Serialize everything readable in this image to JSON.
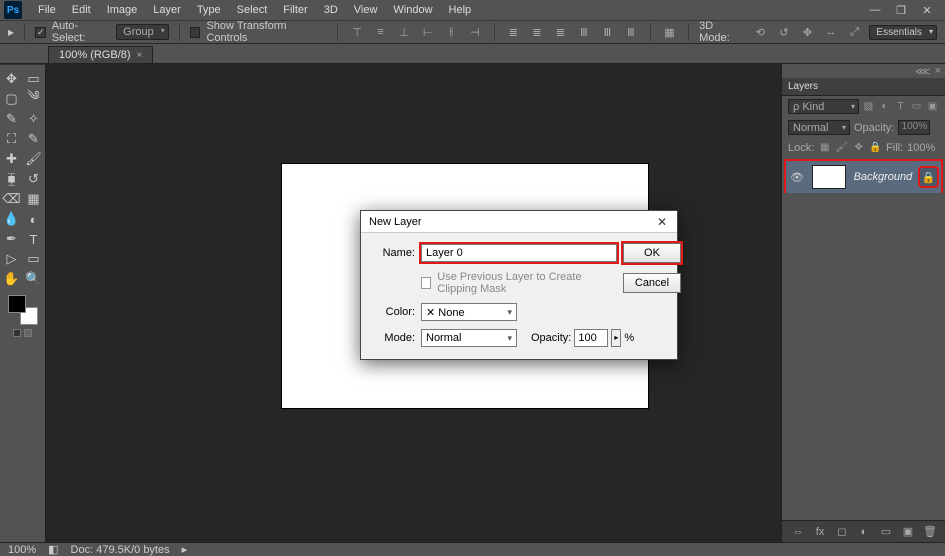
{
  "app": {
    "logo": "Ps"
  },
  "menu": {
    "items": [
      "File",
      "Edit",
      "Image",
      "Layer",
      "Type",
      "Select",
      "Filter",
      "3D",
      "View",
      "Window",
      "Help"
    ]
  },
  "options": {
    "autoSelectLabel": "Auto-Select:",
    "autoSelectTarget": "Group",
    "showTransformLabel": "Show Transform Controls",
    "threeDModeLabel": "3D Mode:"
  },
  "workspace": {
    "label": "Essentials"
  },
  "tab": {
    "title": "100% (RGB/8)"
  },
  "dialog": {
    "title": "New Layer",
    "nameLabel": "Name:",
    "nameValue": "Layer 0",
    "okLabel": "OK",
    "cancelLabel": "Cancel",
    "clipMaskLabel": "Use Previous Layer to Create Clipping Mask",
    "colorLabel": "Color:",
    "colorValue": "✕ None",
    "modeLabel": "Mode:",
    "modeValue": "Normal",
    "opacityLabel": "Opacity:",
    "opacityValue": "100",
    "percent": "%"
  },
  "layersPanel": {
    "title": "Layers",
    "kind": "ρ Kind",
    "blendMode": "Normal",
    "opacityLabel": "Opacity:",
    "opacityValue": "100%",
    "lockLabel": "Lock:",
    "fillLabel": "Fill:",
    "fillValue": "100%",
    "layerName": "Background"
  },
  "status": {
    "zoom": "100%",
    "doc": "Doc: 479.5K/0 bytes"
  }
}
